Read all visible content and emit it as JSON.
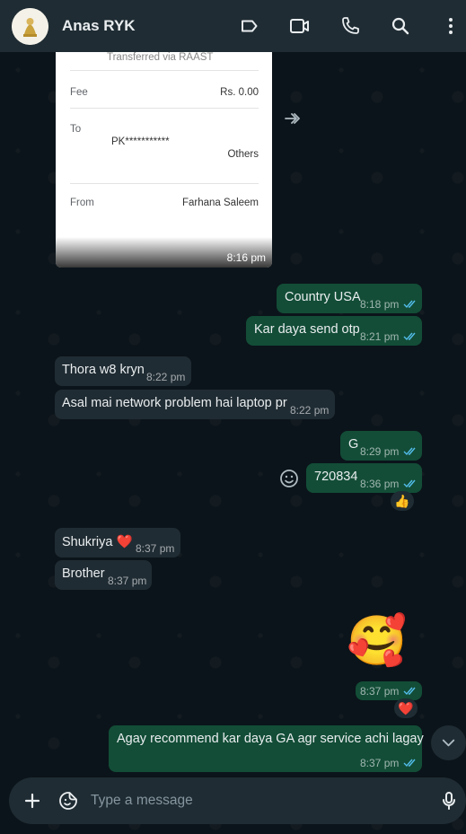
{
  "header": {
    "contact_name": "Anas RYK"
  },
  "payment_card": {
    "caption_top": "Transferred via RAAST",
    "fee_label": "Fee",
    "fee_value": "Rs. 0.00",
    "to_label": "To",
    "to_value": "PK***********",
    "to_sub": "Others",
    "from_label": "From",
    "from_value": "Farhana Saleem",
    "time": "8:16 pm"
  },
  "messages": [
    {
      "dir": "out",
      "text": "Country USA",
      "time": "8:18 pm"
    },
    {
      "dir": "out",
      "text": "Kar daya send otp",
      "time": "8:21 pm"
    },
    {
      "dir": "in",
      "text": "Thora w8 kryn",
      "time": "8:22 pm"
    },
    {
      "dir": "in",
      "text": "Asal mai network problem hai laptop pr",
      "time": "8:22 pm"
    },
    {
      "dir": "out",
      "text": "G",
      "time": "8:29 pm"
    },
    {
      "dir": "out",
      "text": "720834",
      "time": "8:36 pm",
      "reaction": "👍"
    },
    {
      "dir": "in",
      "text": "Shukriya ❤️",
      "time": "8:37 pm"
    },
    {
      "dir": "in",
      "text": "Brother",
      "time": "8:37 pm"
    },
    {
      "dir": "out",
      "text": "🥰",
      "time": "8:37 pm",
      "reaction": "❤️"
    },
    {
      "dir": "out",
      "text": "Agay recommend kar daya GA agr service achi lagay",
      "time": "8:37 pm"
    }
  ],
  "composer": {
    "placeholder": "Type a message"
  },
  "colors": {
    "header_bg": "#1f2c33",
    "incoming": "#202c33",
    "outgoing": "#134d37",
    "tick_read": "#53bdeb",
    "chat_bg": "#0b141a"
  },
  "icons": [
    "label-icon",
    "video-call-icon",
    "voice-call-icon",
    "search-icon",
    "more-options-icon",
    "forward-icon",
    "emoji-react-icon",
    "add-icon",
    "sticker-icon",
    "mic-icon",
    "chevron-down-icon"
  ]
}
